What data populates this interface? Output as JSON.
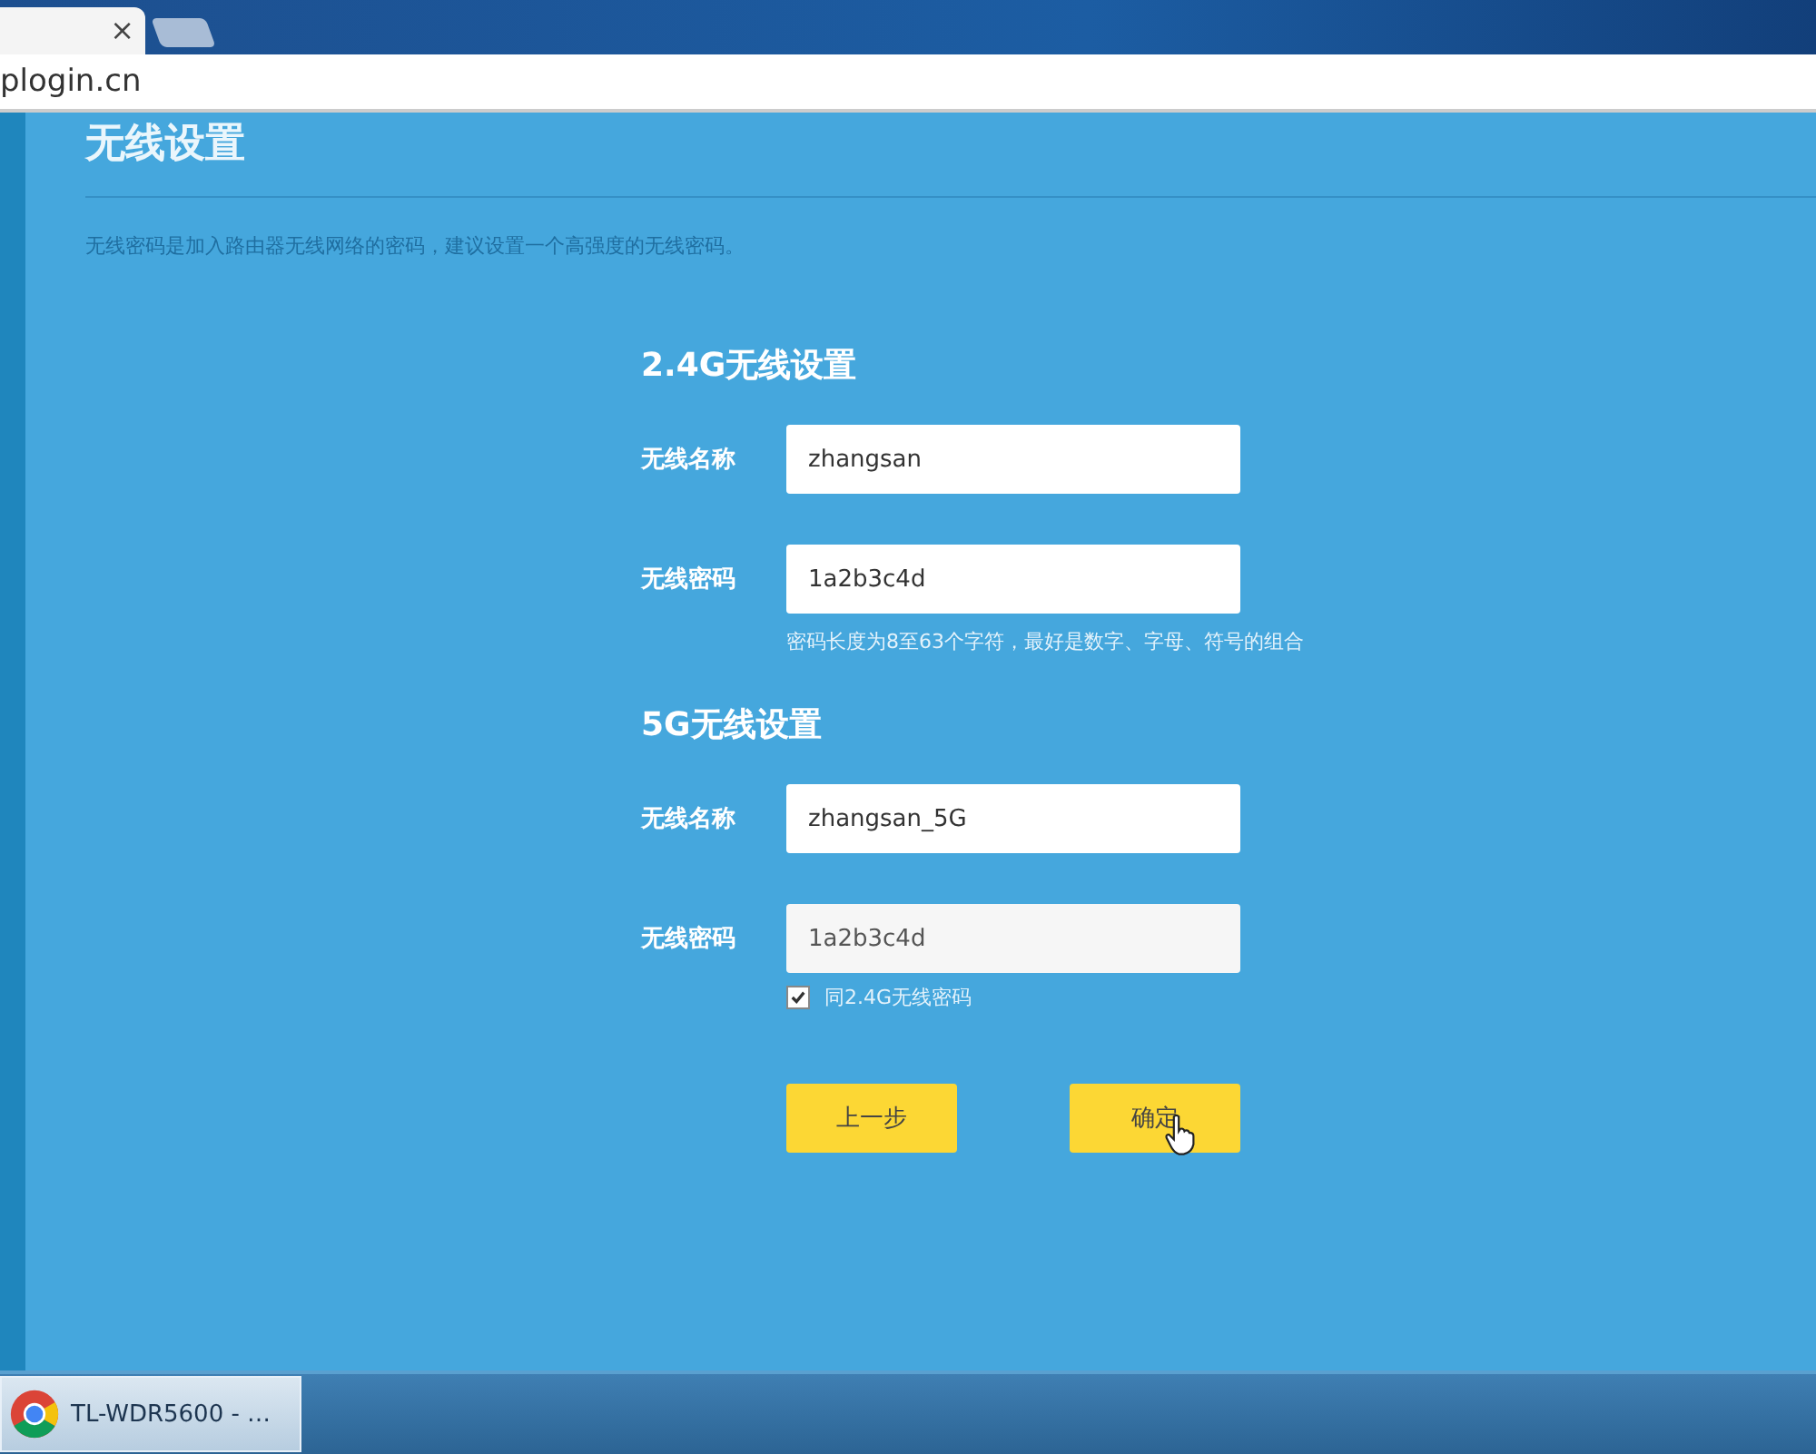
{
  "browser": {
    "tab": {
      "close_glyph": "×"
    },
    "address": "plogin.cn"
  },
  "page": {
    "title": "无线设置",
    "description": "无线密码是加入路由器无线网络的密码，建议设置一个高强度的无线密码。",
    "sections": [
      {
        "title": "2.4G无线设置",
        "fields": [
          {
            "label": "无线名称",
            "value": "zhangsan",
            "disabled": false
          },
          {
            "label": "无线密码",
            "value": "1a2b3c4d",
            "disabled": false
          }
        ],
        "hint": "密码长度为8至63个字符，最好是数字、字母、符号的组合"
      },
      {
        "title": "5G无线设置",
        "fields": [
          {
            "label": "无线名称",
            "value": "zhangsan_5G",
            "disabled": false
          },
          {
            "label": "无线密码",
            "value": "1a2b3c4d",
            "disabled": true
          }
        ],
        "checkbox": {
          "label": "同2.4G无线密码",
          "checked": true
        }
      }
    ],
    "buttons": [
      "上一步",
      "确定"
    ]
  },
  "taskbar": {
    "window": "TL-WDR5600 - …"
  }
}
